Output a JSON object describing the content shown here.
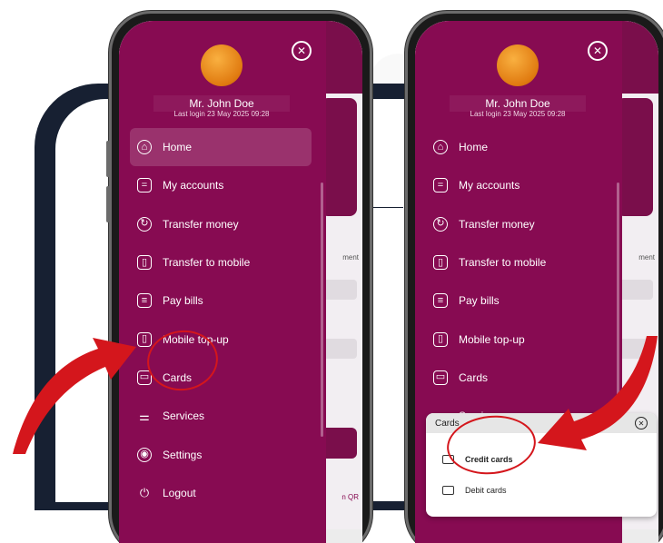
{
  "user": {
    "name": "Mr. John Doe",
    "last_login": "Last login  23 May 2025 09:28"
  },
  "menu": [
    {
      "label": "Home",
      "icon": "home-icon",
      "glyph": "⌂"
    },
    {
      "label": "My accounts",
      "icon": "accounts-icon",
      "glyph": "="
    },
    {
      "label": "Transfer money",
      "icon": "transfer-money-icon",
      "glyph": "↻"
    },
    {
      "label": "Transfer to mobile",
      "icon": "transfer-mobile-icon",
      "glyph": "▯"
    },
    {
      "label": "Pay bills",
      "icon": "pay-bills-icon",
      "glyph": "≡"
    },
    {
      "label": "Mobile top-up",
      "icon": "mobile-topup-icon",
      "glyph": "▯"
    },
    {
      "label": "Cards",
      "icon": "card-icon",
      "glyph": "▭"
    },
    {
      "label": "Services",
      "icon": "services-icon",
      "glyph": "⚌"
    },
    {
      "label": "Settings",
      "icon": "settings-icon",
      "glyph": "◉"
    },
    {
      "label": "Logout",
      "icon": "logout-icon",
      "glyph": "⏻"
    }
  ],
  "sheet": {
    "title": "Cards",
    "items": [
      {
        "label": "Credit cards",
        "icon": "credit-card-icon"
      },
      {
        "label": "Debit cards",
        "icon": "debit-card-icon"
      }
    ]
  },
  "background_app": {
    "text_ment": "ment",
    "text_qr": "n QR"
  },
  "colors": {
    "drawer": "#870b52",
    "annotation": "#d4161c",
    "backdrop": "#172032"
  }
}
